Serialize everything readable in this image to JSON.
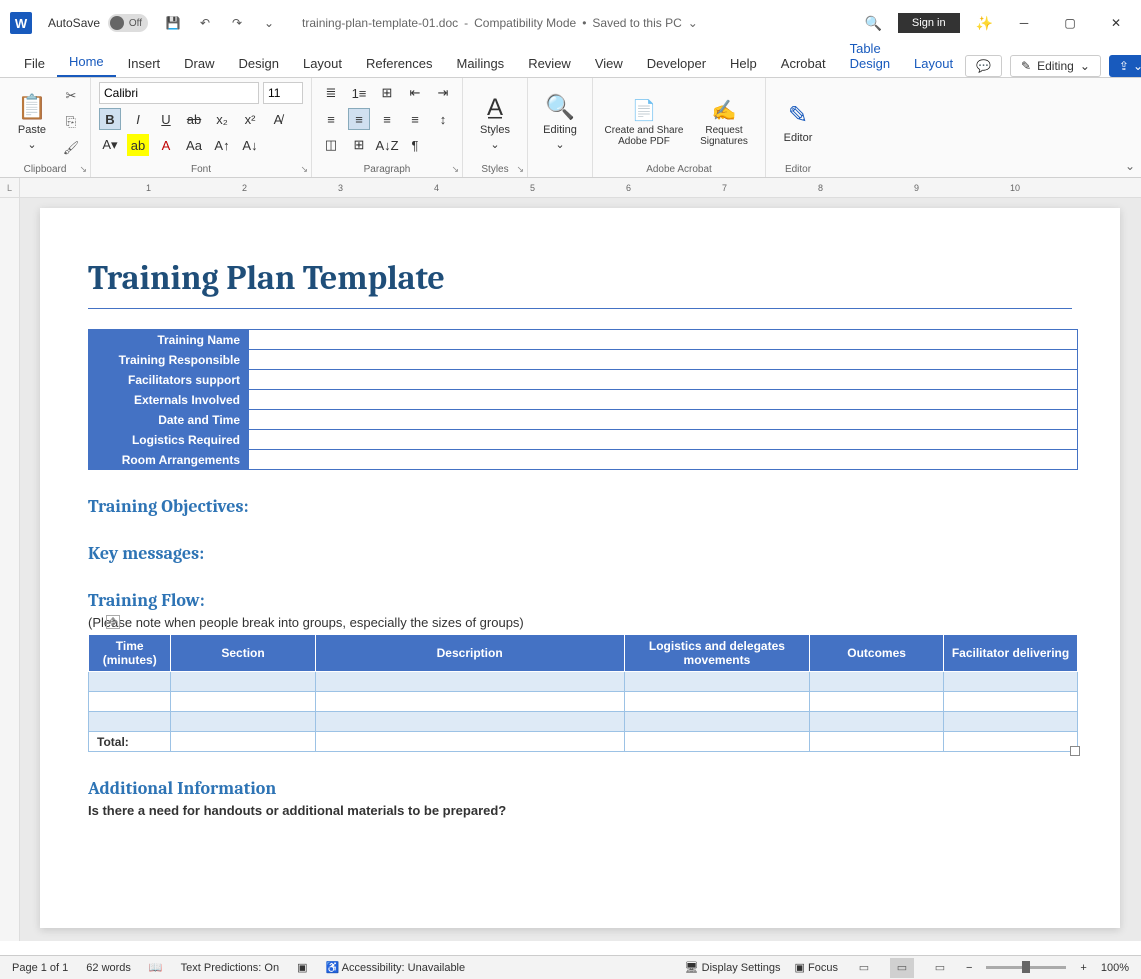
{
  "titlebar": {
    "autosave_label": "AutoSave",
    "autosave_state": "Off",
    "doc_name": "training-plan-template-01.doc",
    "separator": "-",
    "compat": "Compatibility Mode",
    "bullet": "•",
    "saved": "Saved to this PC",
    "signin": "Sign in"
  },
  "tabs": {
    "file": "File",
    "home": "Home",
    "insert": "Insert",
    "draw": "Draw",
    "design": "Design",
    "layout": "Layout",
    "references": "References",
    "mailings": "Mailings",
    "review": "Review",
    "view": "View",
    "developer": "Developer",
    "help": "Help",
    "acrobat": "Acrobat",
    "table_design": "Table Design",
    "table_layout": "Layout",
    "editing_mode": "Editing"
  },
  "ribbon": {
    "clipboard": {
      "paste": "Paste",
      "label": "Clipboard"
    },
    "font": {
      "name": "Calibri",
      "size": "11",
      "bold": "B",
      "italic": "I",
      "underline": "U",
      "strike": "ab",
      "sub": "x₂",
      "sup": "x²",
      "label": "Font"
    },
    "paragraph": {
      "label": "Paragraph"
    },
    "styles": {
      "btn": "Styles",
      "label": "Styles"
    },
    "editing_group": {
      "btn": "Editing"
    },
    "acrobat": {
      "create": "Create and Share Adobe PDF",
      "request": "Request Signatures",
      "label": "Adobe Acrobat"
    },
    "editor": {
      "btn": "Editor",
      "label": "Editor"
    }
  },
  "ruler_h": [
    "1",
    "2",
    "3",
    "4",
    "5",
    "6",
    "7",
    "8",
    "9",
    "10"
  ],
  "document": {
    "title": "Training Plan Template",
    "info_rows": [
      "Training Name",
      "Training Responsible",
      "Facilitators support",
      "Externals Involved",
      "Date and Time",
      "Logistics Required",
      "Room Arrangements"
    ],
    "h_objectives": "Training Objectives:",
    "h_keymsg": "Key messages:",
    "h_flow": "Training Flow:",
    "flow_note": "(Please note when people break into groups, especially the sizes of groups)",
    "flow_headers": {
      "time": "Time (minutes)",
      "section": "Section",
      "description": "Description",
      "logistics": "Logistics and delegates movements",
      "outcomes": "Outcomes",
      "facilitator": "Facilitator delivering"
    },
    "flow_total": "Total:",
    "h_additional": "Additional Information",
    "additional_q": "Is there a need for handouts or additional materials to be prepared?"
  },
  "status": {
    "page": "Page 1 of 1",
    "words": "62 words",
    "predictions": "Text Predictions: On",
    "accessibility": "Accessibility: Unavailable",
    "display": "Display Settings",
    "focus": "Focus",
    "zoom": "100%"
  }
}
